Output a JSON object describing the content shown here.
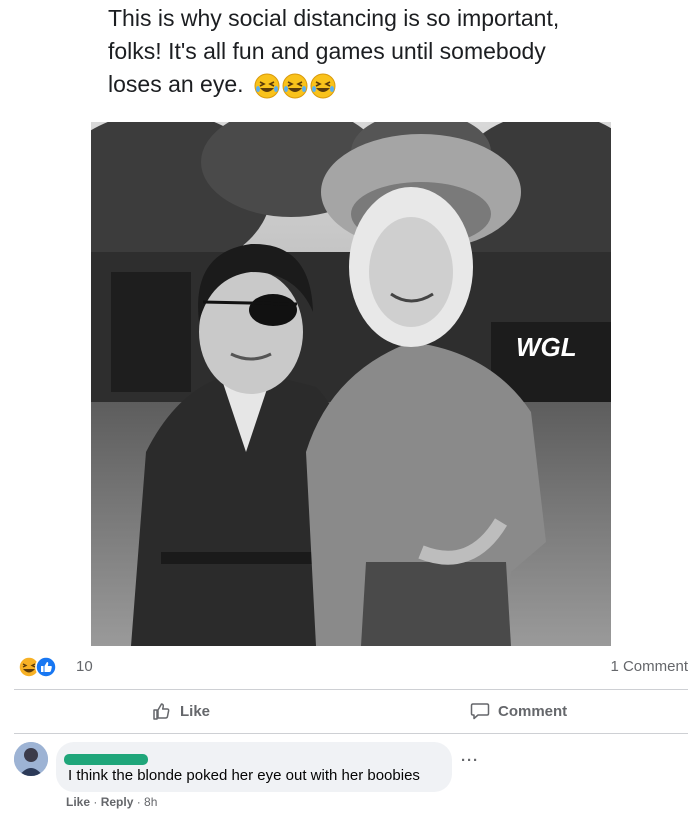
{
  "post": {
    "text": "This is why social distancing is so important, folks!  It's all fun and games until somebody loses an eye.",
    "emojis": [
      "rolling-on-floor-laughing",
      "rolling-on-floor-laughing",
      "rolling-on-floor-laughing"
    ],
    "image_watermark": "WGL"
  },
  "reactions": {
    "icons": [
      "haha-reaction-icon",
      "like-reaction-icon"
    ],
    "count": "10",
    "comments": "1 Comment"
  },
  "actions": {
    "like": "Like",
    "comment": "Comment"
  },
  "comment": {
    "text": "I think the blonde poked her eye out with her boobies",
    "like": "Like",
    "reply": "Reply",
    "separator": " · ",
    "time": "8h",
    "more": "···"
  },
  "colors": {
    "secondary_text": "#65676b",
    "bubble": "#f0f2f5",
    "divider": "#ced0d4",
    "like_blue": "#1877f2",
    "haha_yellow": "#f7b125",
    "redaction": "#1fa67a"
  }
}
